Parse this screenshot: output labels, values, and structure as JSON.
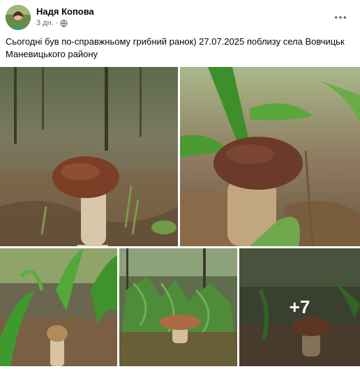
{
  "post": {
    "author": "Надя Копова",
    "time": "3 дн.",
    "separator": "·",
    "audience_icon": "globe-icon",
    "more_icon": "more-options-icon",
    "text": "Сьогодні був по-справжньому грибний ранок) 27.07.2025 поблизу села Вовчицьк Маневицького району"
  },
  "gallery": {
    "more_count": "+7",
    "photos": [
      {
        "subject": "mushroom-in-forest-grass"
      },
      {
        "subject": "mushroom-closeup-with-leaves"
      },
      {
        "subject": "small-mushroom-among-lily-leaves"
      },
      {
        "subject": "mushroom-near-ferns"
      },
      {
        "subject": "mushroom-in-forest-more"
      }
    ]
  },
  "colors": {
    "text_primary": "#050505",
    "text_secondary": "#65676b"
  }
}
